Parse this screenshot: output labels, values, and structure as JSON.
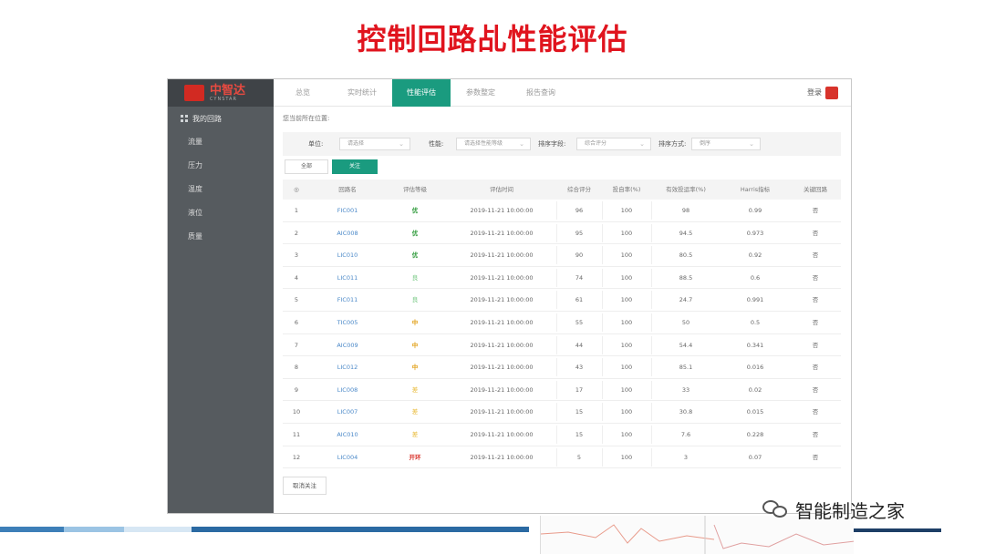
{
  "slide": {
    "title": "控制回路乩性能评估"
  },
  "brand": {
    "cn": "中智达",
    "en": "CYNSTAR"
  },
  "sidebar": {
    "group": "我的回路",
    "items": [
      "流量",
      "压力",
      "温度",
      "液位",
      "质量"
    ]
  },
  "tabs": [
    "总览",
    "实时统计",
    "性能评估",
    "参数整定",
    "报告查询"
  ],
  "active_tab": 2,
  "login": "登录",
  "breadcrumb": "您当前所在位置:",
  "filters": {
    "unit_label": "单位:",
    "unit_value": "请选择",
    "perf_label": "性能:",
    "perf_value": "请选择性能等级",
    "sort_field_label": "排序字段:",
    "sort_field_value": "综合评分",
    "sort_mode_label": "排序方式:",
    "sort_mode_value": "倒序"
  },
  "buttons": {
    "all": "全部",
    "focus": "关注",
    "cancel": "取消关注"
  },
  "table": {
    "headers": [
      "◎",
      "回路名",
      "评估等级",
      "评估时间",
      "综合评分",
      "投自率(%)",
      "有效投运率(%)",
      "Harris指标",
      "关键回路"
    ],
    "rows": [
      {
        "no": "1",
        "name": "FIC001",
        "grade": "优",
        "cls": "g-good",
        "time": "2019-11-21 10:00:00",
        "score": "96",
        "auto": "100",
        "eff": "98",
        "harris": "0.99",
        "key": "否"
      },
      {
        "no": "2",
        "name": "AIC008",
        "grade": "优",
        "cls": "g-good",
        "time": "2019-11-21 10:00:00",
        "score": "95",
        "auto": "100",
        "eff": "94.5",
        "harris": "0.973",
        "key": "否"
      },
      {
        "no": "3",
        "name": "LIC010",
        "grade": "优",
        "cls": "g-good",
        "time": "2019-11-21 10:00:00",
        "score": "90",
        "auto": "100",
        "eff": "80.5",
        "harris": "0.92",
        "key": "否"
      },
      {
        "no": "4",
        "name": "LIC011",
        "grade": "良",
        "cls": "g-ok",
        "time": "2019-11-21 10:00:00",
        "score": "74",
        "auto": "100",
        "eff": "88.5",
        "harris": "0.6",
        "key": "否"
      },
      {
        "no": "5",
        "name": "FIC011",
        "grade": "良",
        "cls": "g-ok",
        "time": "2019-11-21 10:00:00",
        "score": "61",
        "auto": "100",
        "eff": "24.7",
        "harris": "0.991",
        "key": "否"
      },
      {
        "no": "6",
        "name": "TIC005",
        "grade": "中",
        "cls": "g-mid",
        "time": "2019-11-21 10:00:00",
        "score": "55",
        "auto": "100",
        "eff": "50",
        "harris": "0.5",
        "key": "否"
      },
      {
        "no": "7",
        "name": "AIC009",
        "grade": "中",
        "cls": "g-mid",
        "time": "2019-11-21 10:00:00",
        "score": "44",
        "auto": "100",
        "eff": "54.4",
        "harris": "0.341",
        "key": "否"
      },
      {
        "no": "8",
        "name": "LIC012",
        "grade": "中",
        "cls": "g-mid",
        "time": "2019-11-21 10:00:00",
        "score": "43",
        "auto": "100",
        "eff": "85.1",
        "harris": "0.016",
        "key": "否"
      },
      {
        "no": "9",
        "name": "LIC008",
        "grade": "差",
        "cls": "g-poor",
        "time": "2019-11-21 10:00:00",
        "score": "17",
        "auto": "100",
        "eff": "33",
        "harris": "0.02",
        "key": "否"
      },
      {
        "no": "10",
        "name": "LIC007",
        "grade": "差",
        "cls": "g-poor",
        "time": "2019-11-21 10:00:00",
        "score": "15",
        "auto": "100",
        "eff": "30.8",
        "harris": "0.015",
        "key": "否"
      },
      {
        "no": "11",
        "name": "AIC010",
        "grade": "差",
        "cls": "g-poor",
        "time": "2019-11-21 10:00:00",
        "score": "15",
        "auto": "100",
        "eff": "7.6",
        "harris": "0.228",
        "key": "否"
      },
      {
        "no": "12",
        "name": "LIC004",
        "grade": "开环",
        "cls": "g-bad",
        "time": "2019-11-21 10:00:00",
        "score": "5",
        "auto": "100",
        "eff": "3",
        "harris": "0.07",
        "key": "否"
      }
    ]
  },
  "watermark": "智能制造之家",
  "colors": {
    "title": "#e0141e",
    "accent": "#1a9b7f",
    "sidebar": "#565b5f",
    "link": "#4a88c8"
  }
}
